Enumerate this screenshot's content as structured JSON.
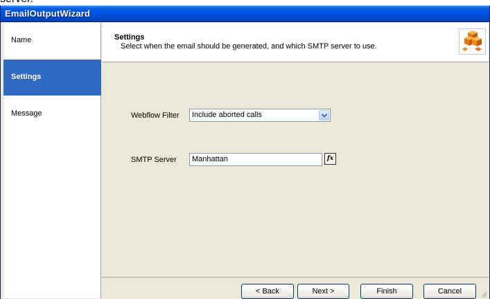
{
  "clipped_text": "server.",
  "window": {
    "title": "EmailOutputWizard"
  },
  "sidebar": {
    "items": [
      {
        "label": "Name"
      },
      {
        "label": "Settings",
        "active": true
      },
      {
        "label": "Message"
      }
    ]
  },
  "header": {
    "title": "Settings",
    "subtitle": "Select when the email should be generated, and which SMTP server to use.",
    "icon": "boxes-icon"
  },
  "form": {
    "webflow_filter": {
      "label": "Webflow Filter",
      "value": "Include aborted calls"
    },
    "smtp_server": {
      "label": "SMTP Server",
      "value": "Manhattan",
      "fx_label": "fx"
    }
  },
  "buttons": {
    "back": "< Back",
    "next": "Next >",
    "finish": "Finish",
    "cancel": "Cancel"
  },
  "colors": {
    "titlebar": "#0054e3",
    "selection": "#316ac5",
    "dialog_bg": "#ece9d8",
    "icon_orange": "#f08a1c"
  }
}
